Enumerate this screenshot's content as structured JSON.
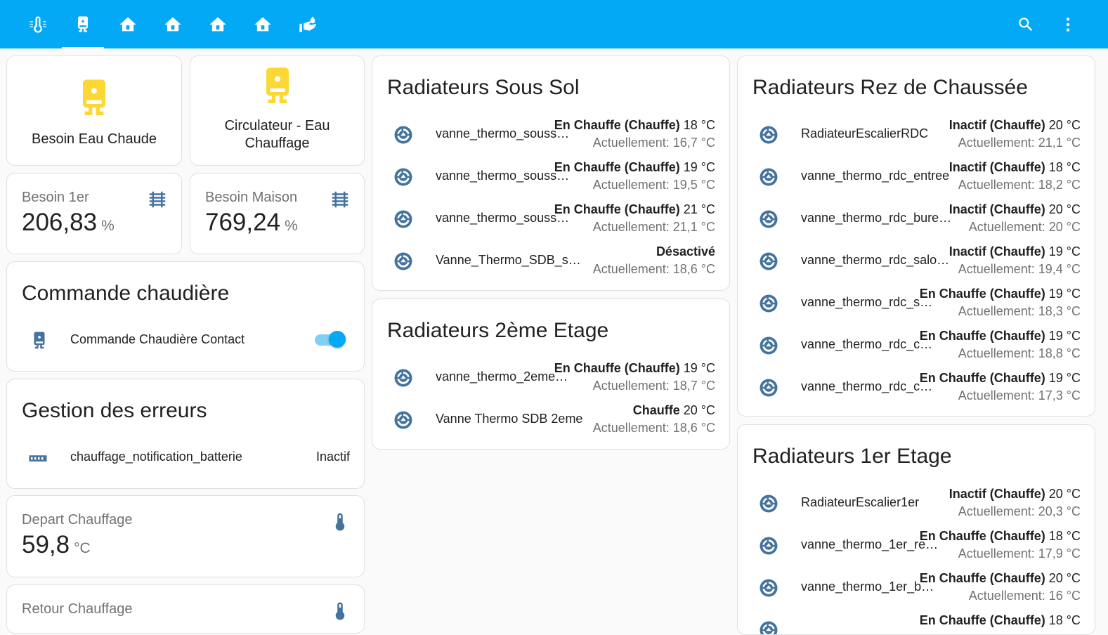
{
  "colors": {
    "header": "#03a9f4",
    "icon": "#44739e",
    "button_icon": "#fdd835"
  },
  "tabs": [
    {
      "icon": "thermometer-lines-icon"
    },
    {
      "icon": "water-boiler-icon",
      "active": true
    },
    {
      "icon": "home-floor-0-icon"
    },
    {
      "icon": "home-floor-1-icon"
    },
    {
      "icon": "home-floor-negative-1-icon"
    },
    {
      "icon": "home-floor-2-icon"
    },
    {
      "icon": "hand-water-icon"
    }
  ],
  "toolbar": {
    "search_icon": "magnify-icon",
    "menu_icon": "dots-vertical-icon"
  },
  "buttons": {
    "besoin_eau": {
      "label": "Besoin Eau Chaude",
      "icon": "water-boiler-icon"
    },
    "circulateur": {
      "label_line1": "Circulateur - Eau",
      "label_line2": "Chauffage",
      "icon": "water-boiler-icon"
    }
  },
  "sensors": {
    "besoin_1er": {
      "name": "Besoin 1er",
      "value": "206,83",
      "unit": "%",
      "icon": "radiator-icon"
    },
    "besoin_maison": {
      "name": "Besoin Maison",
      "value": "769,24",
      "unit": "%",
      "icon": "radiator-icon"
    },
    "depart": {
      "name": "Depart Chauffage",
      "value": "59,8",
      "unit": "°C",
      "icon": "thermometer-icon"
    },
    "retour": {
      "name": "Retour Chauffage",
      "icon": "thermometer-icon"
    }
  },
  "commande": {
    "title": "Commande chaudière",
    "entity": "Commande Chaudière Contact",
    "icon": "water-boiler-icon",
    "toggle_on": true
  },
  "erreurs": {
    "title": "Gestion des erreurs",
    "entity": "chauffage_notification_batterie",
    "state": "Inactif",
    "icon": "sensor-icon"
  },
  "sous_sol": {
    "title": "Radiateurs Sous Sol",
    "rows": [
      {
        "name": "vanne_thermo_souss…",
        "mode": "En Chauffe (Chauffe)",
        "target": "18 °C",
        "current": "Actuellement: 16,7 °C"
      },
      {
        "name": "vanne_thermo_souss…",
        "mode": "En Chauffe (Chauffe)",
        "target": "19 °C",
        "current": "Actuellement: 19,5 °C"
      },
      {
        "name": "vanne_thermo_souss…",
        "mode": "En Chauffe (Chauffe)",
        "target": "21 °C",
        "current": "Actuellement: 21,1 °C"
      },
      {
        "name": "Vanne_Thermo_SDB_sous…",
        "mode": "Désactivé",
        "target": "",
        "current": "Actuellement: 18,6 °C"
      }
    ]
  },
  "deuxieme": {
    "title": "Radiateurs 2ème Etage",
    "rows": [
      {
        "name": "vanne_thermo_2eme…",
        "mode": "En Chauffe (Chauffe)",
        "target": "19 °C",
        "current": "Actuellement: 18,7 °C"
      },
      {
        "name": "Vanne Thermo SDB 2eme",
        "mode": "Chauffe",
        "target": "20 °C",
        "current": "Actuellement: 18,6 °C"
      }
    ]
  },
  "rdc": {
    "title": "Radiateurs Rez de Chaussée",
    "rows": [
      {
        "name": "RadiateurEscalierRDC",
        "mode": "Inactif (Chauffe)",
        "target": "20 °C",
        "current": "Actuellement: 21,1 °C"
      },
      {
        "name": "vanne_thermo_rdc_entree",
        "mode": "Inactif (Chauffe)",
        "target": "18 °C",
        "current": "Actuellement: 18,2 °C"
      },
      {
        "name": "vanne_thermo_rdc_bureau",
        "mode": "Inactif (Chauffe)",
        "target": "20 °C",
        "current": "Actuellement: 20 °C"
      },
      {
        "name": "vanne_thermo_rdc_salon_…",
        "mode": "Inactif (Chauffe)",
        "target": "19 °C",
        "current": "Actuellement: 19,4 °C"
      },
      {
        "name": "vanne_thermo_rdc_s…",
        "mode": "En Chauffe (Chauffe)",
        "target": "19 °C",
        "current": "Actuellement: 18,3 °C"
      },
      {
        "name": "vanne_thermo_rdc_c…",
        "mode": "En Chauffe (Chauffe)",
        "target": "19 °C",
        "current": "Actuellement: 18,8 °C"
      },
      {
        "name": "vanne_thermo_rdc_c…",
        "mode": "En Chauffe (Chauffe)",
        "target": "19 °C",
        "current": "Actuellement: 17,3 °C"
      }
    ]
  },
  "premier": {
    "title": "Radiateurs 1er Etage",
    "rows": [
      {
        "name": "RadiateurEscalier1er",
        "mode": "Inactif (Chauffe)",
        "target": "20 °C",
        "current": "Actuellement: 20,3 °C"
      },
      {
        "name": "vanne_thermo_1er_re…",
        "mode": "En Chauffe (Chauffe)",
        "target": "18 °C",
        "current": "Actuellement: 17,9 °C"
      },
      {
        "name": "vanne_thermo_1er_b…",
        "mode": "En Chauffe (Chauffe)",
        "target": "20 °C",
        "current": "Actuellement: 16 °C"
      },
      {
        "name": "",
        "mode": "En Chauffe (Chauffe)",
        "target": "18 °C",
        "current": ""
      }
    ]
  }
}
